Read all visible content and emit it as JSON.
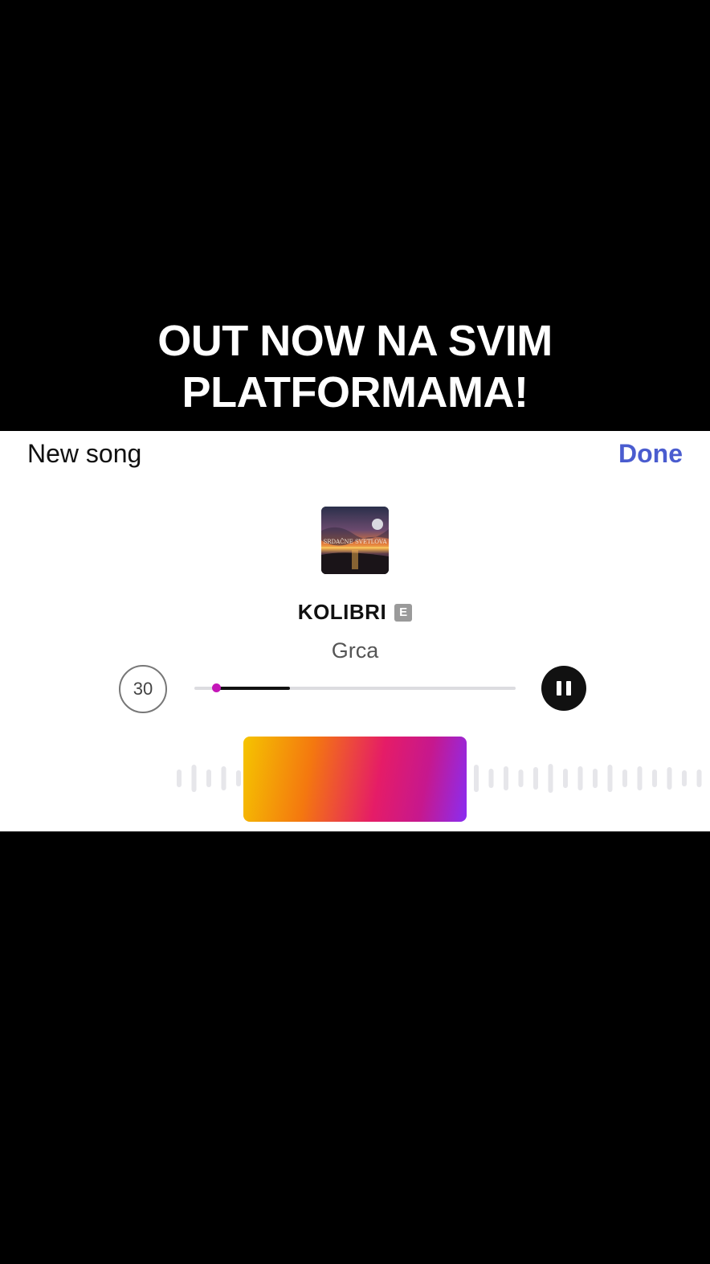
{
  "caption": {
    "line1": "OUT NOW NA SVIM",
    "line2": "PLATFORMAMA!"
  },
  "header": {
    "title": "New song",
    "done_label": "Done"
  },
  "song": {
    "title": "KOLIBRI",
    "explicit_badge": "E",
    "artist": "Grca",
    "cover_text": "SRDAČNE SVETLOVA"
  },
  "player": {
    "duration_label": "30",
    "progress_fraction": 0.23,
    "knob_fraction": 0.0,
    "state": "playing"
  },
  "icons": {
    "pause": "pause-icon",
    "explicit": "explicit-icon"
  },
  "colors": {
    "done": "#4a5ccf",
    "knob": "#c416b8",
    "selector_gradient": [
      "#f5c400",
      "#f4780f",
      "#e51c67",
      "#c6188e",
      "#8a2df2"
    ]
  }
}
